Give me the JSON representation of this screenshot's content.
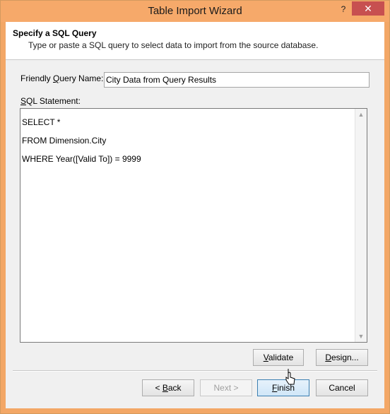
{
  "window": {
    "title": "Table Import Wizard",
    "help_label": "?",
    "close_label": "✕"
  },
  "header": {
    "title": "Specify a SQL Query",
    "subtitle": "Type or paste a SQL query to select data to import from the source database."
  },
  "form": {
    "friendly_label_pre": "Friendly ",
    "friendly_label_mnemonic": "Q",
    "friendly_label_post": "uery Name:",
    "friendly_value": "City Data from Query Results",
    "sql_label_mnemonic": "S",
    "sql_label_post": "QL Statement:",
    "sql_lines": [
      "SELECT *",
      "FROM Dimension.City",
      "WHERE Year([Valid To]) = 9999"
    ]
  },
  "buttons": {
    "validate": {
      "mnemonic": "V",
      "rest": "alidate"
    },
    "design": {
      "mnemonic": "D",
      "rest": "esign..."
    },
    "back": {
      "prefix": "< ",
      "mnemonic": "B",
      "rest": "ack"
    },
    "next": "Next >",
    "finish": {
      "mnemonic": "F",
      "rest": "inish"
    },
    "cancel": "Cancel"
  }
}
